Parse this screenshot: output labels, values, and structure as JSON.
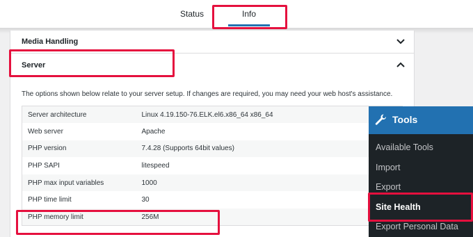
{
  "tabs": [
    {
      "label": "Status"
    },
    {
      "label": "Info"
    }
  ],
  "sections": {
    "media_handling": "Media Handling",
    "server": "Server"
  },
  "server_description": "The options shown below relate to your server setup. If changes are required, you may need your web host's assistance.",
  "server_rows": [
    {
      "key": "Server architecture",
      "value": "Linux 4.19.150-76.ELK.el6.x86_64 x86_64"
    },
    {
      "key": "Web server",
      "value": "Apache"
    },
    {
      "key": "PHP version",
      "value": "7.4.28 (Supports 64bit values)"
    },
    {
      "key": "PHP SAPI",
      "value": "litespeed"
    },
    {
      "key": "PHP max input variables",
      "value": "1000"
    },
    {
      "key": "PHP time limit",
      "value": "30"
    },
    {
      "key": "PHP memory limit",
      "value": "256M"
    }
  ],
  "tools_menu": {
    "title": "Tools",
    "items": [
      "Available Tools",
      "Import",
      "Export",
      "Site Health",
      "Export Personal Data"
    ],
    "active_item": "Site Health"
  },
  "colors": {
    "highlight": "#e5103e",
    "accent": "#2271b1",
    "menu_bg": "#1d2327"
  },
  "icons": [
    "chevron-down-icon",
    "chevron-up-icon",
    "wrench-icon"
  ]
}
